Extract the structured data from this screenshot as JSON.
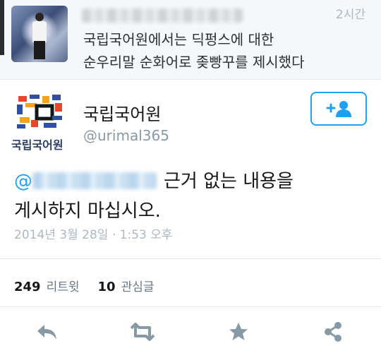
{
  "parent_tweet": {
    "time": "2시간",
    "text_line1": "국립국어원에서는 딕펑스에 대한",
    "text_line2": "순우리말 순화어로 좆빵꾸를 제시했다"
  },
  "account": {
    "logo_label": "국립국어원",
    "name": "국립국어원",
    "handle": "@urimal365"
  },
  "reply": {
    "at": "@",
    "text_line1": "근거 없는 내용을",
    "text_line2": "게시하지 마십시오."
  },
  "timestamp": "2014년 3월 28일 · 1:53 오후",
  "stats": {
    "retweets_count": "249",
    "retweets_label": "리트윗",
    "favorites_count": "10",
    "favorites_label": "관심글"
  },
  "icons": {
    "reply": "reply-icon",
    "retweet": "retweet-icon",
    "favorite": "star-icon",
    "share": "share-icon",
    "follow": "add-user-icon"
  },
  "colors": {
    "accent": "#1da1f2",
    "icon_gray": "#8899a6",
    "muted_text": "#aab8c2"
  }
}
